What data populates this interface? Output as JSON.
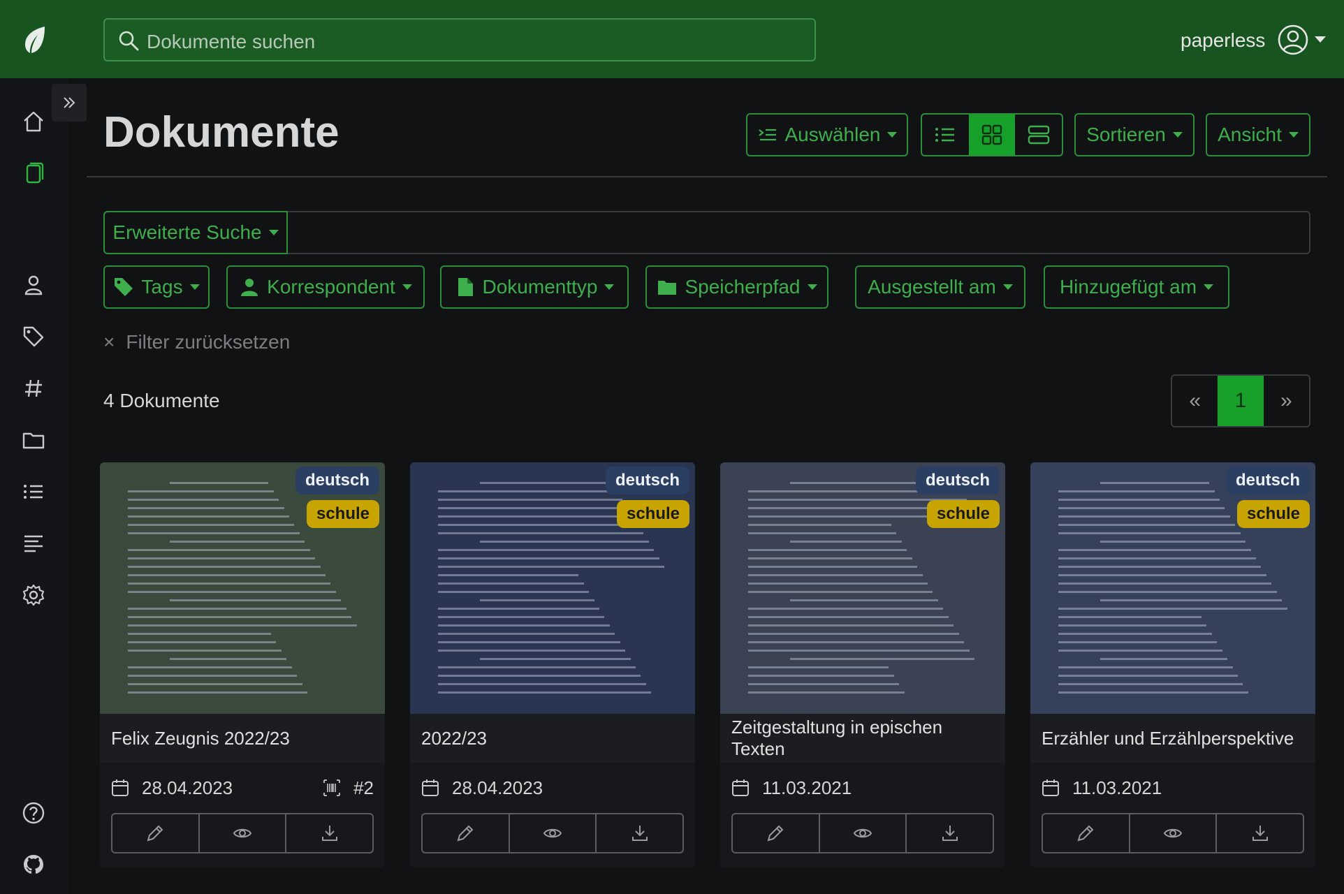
{
  "app": {
    "user": "paperless"
  },
  "search": {
    "placeholder": "Dokumente suchen"
  },
  "page": {
    "title": "Dokumente"
  },
  "toolbar": {
    "select_label": "Auswählen",
    "sort_label": "Sortieren",
    "view_label": "Ansicht",
    "view_mode_active": "grid"
  },
  "filters": {
    "advanced_search": "Erweiterte Suche",
    "tags": "Tags",
    "correspondent": "Korrespondent",
    "document_type": "Dokumenttyp",
    "storage_path": "Speicherpfad",
    "created": "Ausgestellt am",
    "added": "Hinzugefügt am",
    "reset": "Filter zurücksetzen"
  },
  "results": {
    "count_label": "4 Dokumente"
  },
  "pagination": {
    "prev": "«",
    "current": "1",
    "next": "»"
  },
  "colors": {
    "topbar": "#17541f",
    "accent": "#17a02a",
    "tag_deutsch": "#2b3f63",
    "tag_schule": "#c7a400"
  },
  "documents": [
    {
      "title": "Felix Zeugnis 2022/23",
      "date": "28.04.2023",
      "asn": "#2",
      "tags": [
        "deutsch",
        "schule"
      ]
    },
    {
      "title": "2022/23",
      "date": "28.04.2023",
      "asn": "",
      "tags": [
        "deutsch",
        "schule"
      ]
    },
    {
      "title": "Zeitgestaltung in epischen Texten",
      "date": "11.03.2021",
      "asn": "",
      "tags": [
        "deutsch",
        "schule"
      ]
    },
    {
      "title": "Erzähler und Erzählperspektive",
      "date": "11.03.2021",
      "asn": "",
      "tags": [
        "deutsch",
        "schule"
      ]
    }
  ],
  "sidebar_icons": [
    "home-icon",
    "documents-icon",
    "user-icon",
    "tag-icon",
    "hash-icon",
    "folder-icon",
    "list-icon",
    "text-icon",
    "gear-icon",
    "help-icon",
    "github-icon"
  ]
}
